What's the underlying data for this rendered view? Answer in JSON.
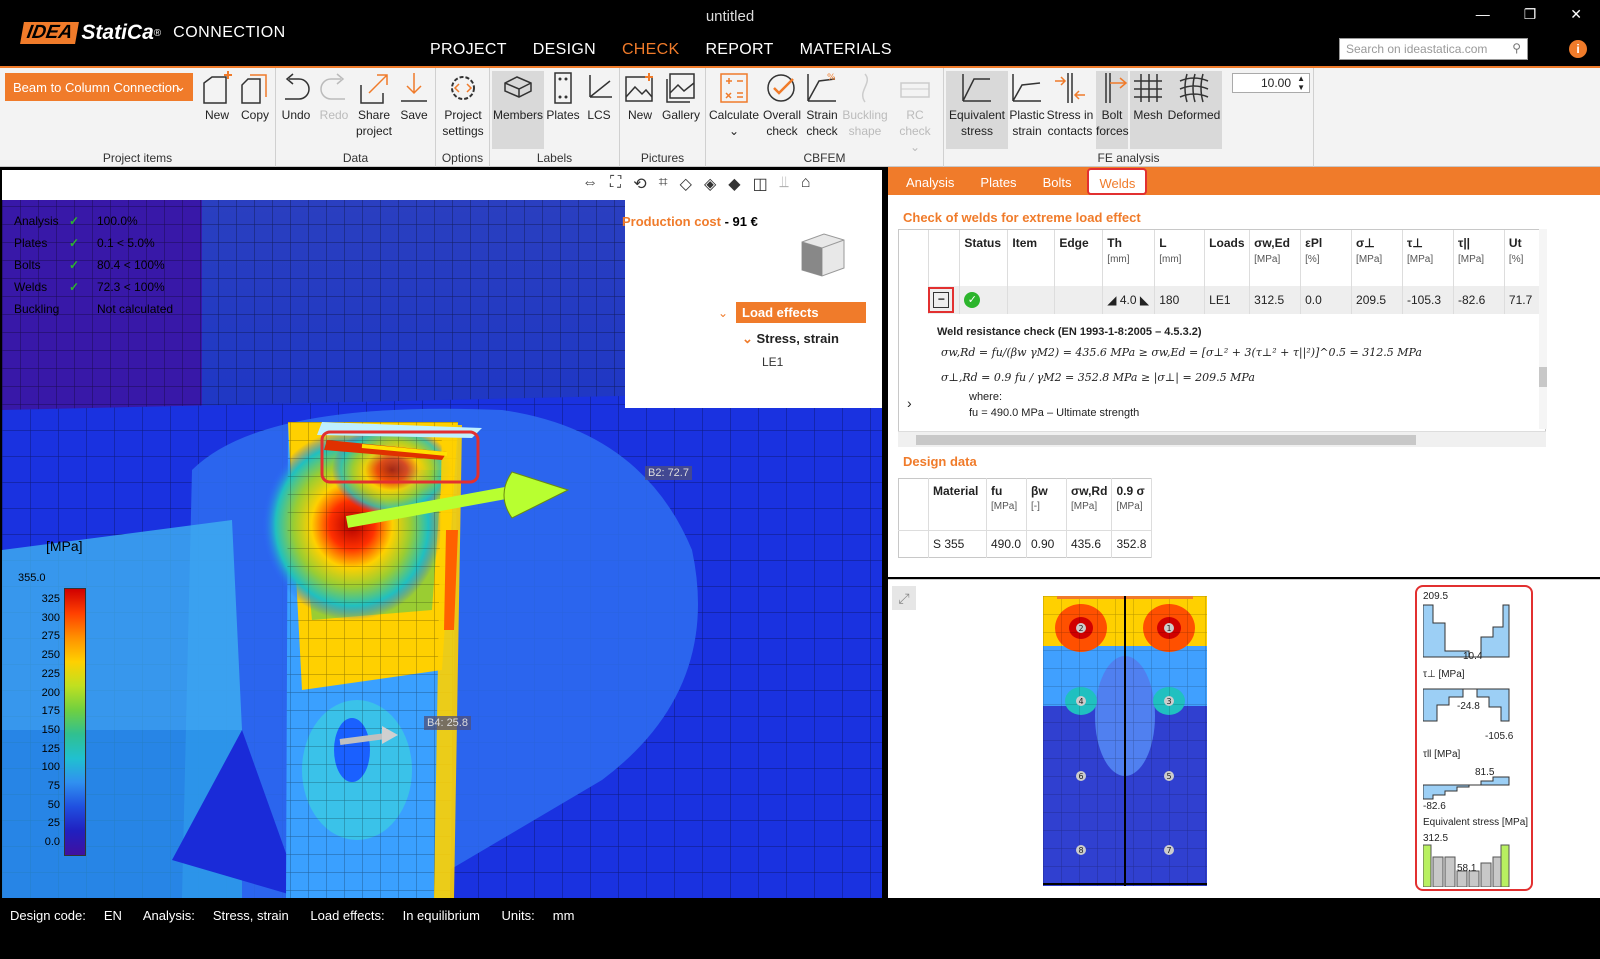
{
  "window": {
    "title": "untitled",
    "min": "—",
    "max": "❐",
    "close": "✕"
  },
  "brand": {
    "idea": "IDEA",
    "statica": "StatiCa",
    "reg": "®",
    "product": "CONNECTION"
  },
  "nav": {
    "items": [
      "PROJECT",
      "DESIGN",
      "CHECK",
      "REPORT",
      "MATERIALS"
    ],
    "active": "CHECK"
  },
  "search": {
    "placeholder": "Search on ideastatica.com"
  },
  "ribbon": {
    "project_dropdown": "Beam to Column Connection",
    "groups": {
      "project_items": "Project items",
      "data": "Data",
      "options": "Options",
      "labels": "Labels",
      "pictures": "Pictures",
      "cbfem": "CBFEM",
      "fe_analysis": "FE analysis"
    },
    "buttons": {
      "new": "New",
      "copy": "Copy",
      "undo": "Undo",
      "redo": "Redo",
      "share1": "Share",
      "share2": "project",
      "save": "Save",
      "settings1": "Project",
      "settings2": "settings",
      "members": "Members",
      "plates": "Plates",
      "lcs": "LCS",
      "pic_new": "New",
      "gallery": "Gallery",
      "calculate": "Calculate",
      "overall1": "Overall",
      "overall2": "check",
      "strain1": "Strain",
      "strain2": "check",
      "buckling1": "Buckling",
      "buckling2": "shape",
      "rc1": "RC check",
      "eq1": "Equivalent",
      "eq2": "stress",
      "plastic1": "Plastic",
      "plastic2": "strain",
      "stressc1": "Stress in",
      "stressc2": "contacts",
      "bolt1": "Bolt",
      "bolt2": "forces",
      "mesh": "Mesh",
      "deformed": "Deformed"
    },
    "deform_scale": "10.00"
  },
  "viewport": {
    "summary": [
      {
        "k": "Analysis",
        "v": "100.0%"
      },
      {
        "k": "Plates",
        "v": "0.1 < 5.0%"
      },
      {
        "k": "Bolts",
        "v": "80.4 < 100%"
      },
      {
        "k": "Welds",
        "v": "72.3 < 100%"
      },
      {
        "k": "Buckling",
        "v": "Not calculated"
      }
    ],
    "production_cost_label": "Production cost",
    "production_cost_value": "- 91 €",
    "tree": {
      "load_effects": "Load effects",
      "stress_strain": "Stress, strain",
      "le1": "LE1"
    },
    "legend": {
      "unit": "[MPa]",
      "max": "355.0",
      "ticks": [
        "325",
        "300",
        "275",
        "250",
        "225",
        "200",
        "175",
        "150",
        "125",
        "100",
        "75",
        "50",
        "25",
        "0.0"
      ]
    },
    "tags": {
      "b2": "B2: 72.7",
      "b4": "B4: 25.8"
    }
  },
  "tabs": [
    "Analysis",
    "Plates",
    "Bolts",
    "Welds"
  ],
  "active_tab": "Welds",
  "welds": {
    "title": "Check of welds for extreme load effect",
    "headers": [
      {
        "t": "Status",
        "u": ""
      },
      {
        "t": "Item",
        "u": ""
      },
      {
        "t": "Edge",
        "u": ""
      },
      {
        "t": "Th",
        "u": "[mm]"
      },
      {
        "t": "L",
        "u": "[mm]"
      },
      {
        "t": "Loads",
        "u": ""
      },
      {
        "t": "σw,Ed",
        "u": "[MPa]"
      },
      {
        "t": "εPl",
        "u": "[%]"
      },
      {
        "t": "σ⊥",
        "u": "[MPa]"
      },
      {
        "t": "τ⊥",
        "u": "[MPa]"
      },
      {
        "t": "τ||",
        "u": "[MPa]"
      },
      {
        "t": "Ut",
        "u": "[%]"
      }
    ],
    "row": {
      "th": "◢ 4.0 ◣",
      "l": "180",
      "loads": "LE1",
      "sigma_wed": "312.5",
      "eps": "0.0",
      "sigma_perp": "209.5",
      "tau_perp": "-105.3",
      "tau_par": "-82.6",
      "ut": "71.7"
    },
    "detail": {
      "heading": "Weld resistance check (EN 1993-1-8:2005 – 4.5.3.2)",
      "line1": "σw,Rd = fu/(βw γM2) =   435.6   MPa   ≥   σw,Ed = [σ⊥² + 3(τ⊥² + τ||²)]^0.5 =   312.5   MPa",
      "line2": "σ⊥,Rd = 0.9 fu / γM2 =   352.8   MPa   ≥   |σ⊥| =   209.5   MPa",
      "where": "where:",
      "line3": "fu = 490.0 MPa   – Ultimate strength"
    }
  },
  "design": {
    "title": "Design data",
    "headers": [
      {
        "t": "Material",
        "u": ""
      },
      {
        "t": "fu",
        "u": "[MPa]"
      },
      {
        "t": "βw",
        "u": "[-]"
      },
      {
        "t": "σw,Rd",
        "u": "[MPa]"
      },
      {
        "t": "0.9 σ",
        "u": "[MPa]"
      }
    ],
    "row": [
      "S 355",
      "490.0",
      "0.90",
      "435.6",
      "352.8"
    ]
  },
  "diagrams": {
    "sigma_perp_max": "209.5",
    "sigma_perp_min": "10.4",
    "tau_perp_label": "τ⊥ [MPa]",
    "tau_perp_a": "-24.8",
    "tau_perp_b": "-105.6",
    "tau_par_label": "τll [MPa]",
    "tau_par_a": "81.5",
    "tau_par_b": "-82.6",
    "eq_label": "Equivalent stress [MPa]",
    "eq_max": "312.5",
    "eq_min": "58.1"
  },
  "plate_bolts": [
    "1",
    "2",
    "3",
    "4",
    "5",
    "6",
    "7",
    "8"
  ],
  "statusbar": {
    "design_code_label": "Design code:",
    "design_code": "EN",
    "analysis_label": "Analysis:",
    "analysis": "Stress, strain",
    "load_label": "Load effects:",
    "load": "In equilibrium",
    "units_label": "Units:",
    "units": "mm"
  }
}
